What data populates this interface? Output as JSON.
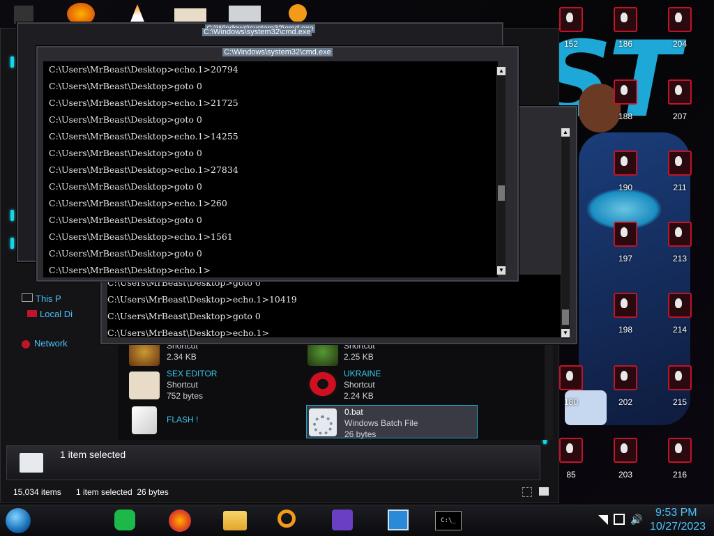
{
  "desktop": {
    "icons": [
      {
        "label": "152",
        "col": 0,
        "row": 0
      },
      {
        "label": "186",
        "col": 1,
        "row": 0
      },
      {
        "label": "204",
        "col": 2,
        "row": 0
      },
      {
        "label": "188",
        "col": 1,
        "row": 1
      },
      {
        "label": "207",
        "col": 2,
        "row": 1
      },
      {
        "label": "190",
        "col": 1,
        "row": 2
      },
      {
        "label": "211",
        "col": 2,
        "row": 2
      },
      {
        "label": "197",
        "col": 1,
        "row": 3
      },
      {
        "label": "213",
        "col": 2,
        "row": 3
      },
      {
        "label": "198",
        "col": 1,
        "row": 4
      },
      {
        "label": "214",
        "col": 2,
        "row": 4
      },
      {
        "label": "180",
        "col": 0,
        "row": 5
      },
      {
        "label": "202",
        "col": 1,
        "row": 5
      },
      {
        "label": "215",
        "col": 2,
        "row": 5
      },
      {
        "label": "85",
        "col": 0,
        "row": 6
      },
      {
        "label": "203",
        "col": 1,
        "row": 6
      },
      {
        "label": "216",
        "col": 2,
        "row": 6
      }
    ]
  },
  "cmd_back": {
    "title": "C:\\Windows\\system32\\cmd.exe",
    "lines": [
      "C:\\Users\\MrBeast\\Desktop>goto 0",
      "C:\\Users\\MrBeast\\Desktop>echo.1>10419",
      "C:\\Users\\MrBeast\\Desktop>goto 0",
      "C:\\Users\\MrBeast\\Desktop>echo.1>"
    ]
  },
  "cmd_front": {
    "title": "C:\\Windows\\system32\\cmd.exe",
    "lines": [
      "C:\\Users\\MrBeast\\Desktop>echo.1>20794",
      "C:\\Users\\MrBeast\\Desktop>goto 0",
      "C:\\Users\\MrBeast\\Desktop>echo.1>21725",
      "C:\\Users\\MrBeast\\Desktop>goto 0",
      "C:\\Users\\MrBeast\\Desktop>echo.1>14255",
      "C:\\Users\\MrBeast\\Desktop>goto 0",
      "C:\\Users\\MrBeast\\Desktop>echo.1>27834",
      "C:\\Users\\MrBeast\\Desktop>goto 0",
      "C:\\Users\\MrBeast\\Desktop>echo.1>260",
      "C:\\Users\\MrBeast\\Desktop>goto 0",
      "C:\\Users\\MrBeast\\Desktop>echo.1>1561",
      "C:\\Users\\MrBeast\\Desktop>goto 0",
      "C:\\Users\\MrBeast\\Desktop>echo.1>"
    ]
  },
  "cmd_hidden": {
    "title": "C:\\Windows\\system32\\cmd.exe"
  },
  "explorer": {
    "nav": {
      "this_pc": "This P",
      "local_disk": "Local Di",
      "network": "Network"
    },
    "files": [
      {
        "name": "",
        "type": "Shortcut",
        "size": "2.34 KB"
      },
      {
        "name": "",
        "type": "Shortcut",
        "size": "2.25 KB"
      },
      {
        "name": "SEX EDITOR",
        "type": "Shortcut",
        "size": "752 bytes"
      },
      {
        "name": "UKRAINE",
        "type": "Shortcut",
        "size": "2.24 KB"
      },
      {
        "name": "FLASH !",
        "type": "",
        "size": ""
      },
      {
        "name": "0.bat",
        "type": "Windows Batch File",
        "size": "26 bytes"
      }
    ],
    "details_pane": {
      "text": "1 item selected"
    },
    "status": {
      "items": "15,034 items",
      "selected": "1 item selected  26 bytes"
    }
  },
  "taskbar": {
    "time": "9:53 PM",
    "date": "10/27/2023",
    "apps": [
      "notes-app",
      "firefox",
      "file-explorer",
      "search-magnifier",
      "trophy-app",
      "photos-app",
      "cmd-prompt"
    ],
    "cmd_glyph": "C:\\_"
  },
  "colors": {
    "accent": "#19d3e6",
    "link": "#3cc7ea",
    "selection": "#3a3a44",
    "wallpaper_text": "#1ea8d8"
  }
}
